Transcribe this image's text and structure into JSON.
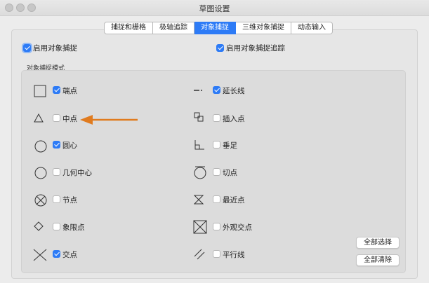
{
  "window": {
    "title": "草图设置"
  },
  "tabs": [
    {
      "label": "捕捉和栅格",
      "active": false
    },
    {
      "label": "极轴追踪",
      "active": false
    },
    {
      "label": "对象捕捉",
      "active": true
    },
    {
      "label": "三维对象捕捉",
      "active": false
    },
    {
      "label": "动态输入",
      "active": false
    }
  ],
  "top_options": {
    "enable_osnap": {
      "label": "启用对象捕捉",
      "checked": true
    },
    "enable_tracking": {
      "label": "启用对象捕捉追踪",
      "checked": true
    }
  },
  "modes_group": {
    "title": "对象捕捉模式",
    "left": [
      {
        "label": "端点",
        "checked": true,
        "icon": "square-icon"
      },
      {
        "label": "中点",
        "checked": false,
        "icon": "triangle-icon"
      },
      {
        "label": "圆心",
        "checked": true,
        "icon": "circle-icon"
      },
      {
        "label": "几何中心",
        "checked": false,
        "icon": "circle-icon"
      },
      {
        "label": "节点",
        "checked": false,
        "icon": "node-icon"
      },
      {
        "label": "象限点",
        "checked": false,
        "icon": "diamond-icon"
      },
      {
        "label": "交点",
        "checked": true,
        "icon": "cross-icon"
      }
    ],
    "right": [
      {
        "label": "延长线",
        "checked": true,
        "icon": "extension-icon"
      },
      {
        "label": "插入点",
        "checked": false,
        "icon": "insert-icon"
      },
      {
        "label": "垂足",
        "checked": false,
        "icon": "perpendicular-icon"
      },
      {
        "label": "切点",
        "checked": false,
        "icon": "tangent-icon"
      },
      {
        "label": "最近点",
        "checked": false,
        "icon": "hourglass-icon"
      },
      {
        "label": "外观交点",
        "checked": false,
        "icon": "apparent-intersection-icon"
      },
      {
        "label": "平行线",
        "checked": false,
        "icon": "parallel-icon"
      }
    ]
  },
  "buttons": {
    "select_all": "全部选择",
    "clear_all": "全部清除"
  },
  "annotation": {
    "arrow_color": "#e07b1f",
    "accent": "#2d7bf6"
  }
}
